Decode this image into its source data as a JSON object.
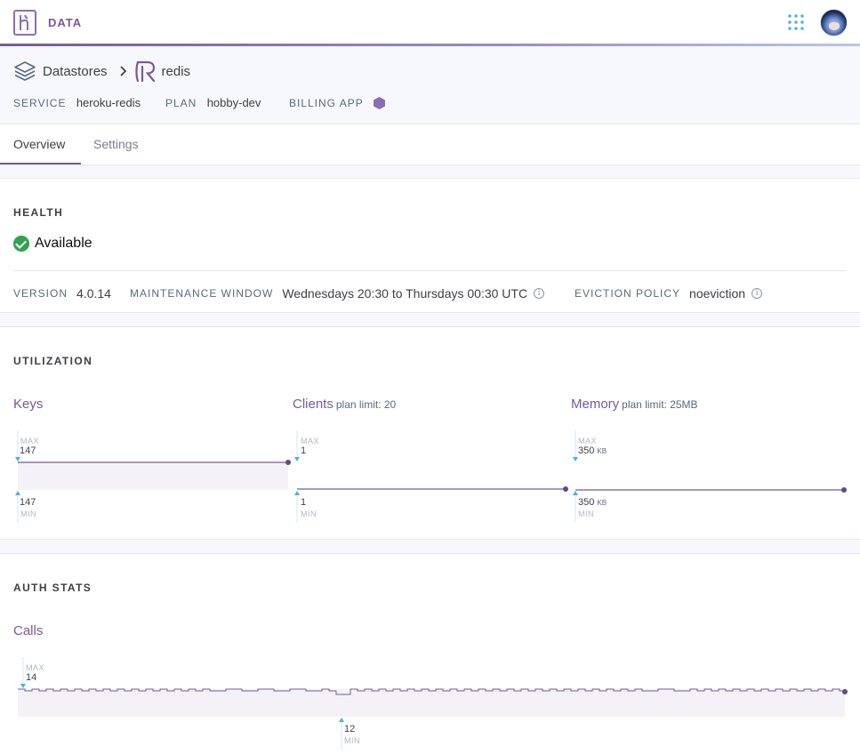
{
  "topbar": {
    "app_name": "DATA"
  },
  "breadcrumb": {
    "parent": "Datastores",
    "current": "redis"
  },
  "service": {
    "service_label": "SERVICE",
    "service_value": "heroku-redis",
    "plan_label": "PLAN",
    "plan_value": "hobby-dev",
    "billing_label": "BILLING APP"
  },
  "tabs": [
    {
      "label": "Overview"
    },
    {
      "label": "Settings"
    }
  ],
  "health": {
    "title": "HEALTH",
    "status": "Available",
    "version_label": "VERSION",
    "version_value": "4.0.14",
    "maintenance_label": "MAINTENANCE WINDOW",
    "maintenance_value": "Wednesdays 20:30 to Thursdays 00:30 UTC",
    "eviction_label": "EVICTION POLICY",
    "eviction_value": "noeviction"
  },
  "utilization": {
    "title": "UTILIZATION",
    "keys": {
      "title": "Keys",
      "max_label": "MAX",
      "max": "147",
      "min": "147",
      "min_label": "MIN"
    },
    "clients": {
      "title": "Clients",
      "limit": "plan limit: 20",
      "max_label": "MAX",
      "max": "1",
      "min": "1",
      "min_label": "MIN"
    },
    "memory": {
      "title": "Memory",
      "limit": "plan limit: 25MB",
      "max_label": "MAX",
      "max": "350",
      "max_unit": "KB",
      "min": "350",
      "min_unit": "KB",
      "min_label": "MIN"
    }
  },
  "auth": {
    "title": "AUTH STATS",
    "calls": {
      "title": "Calls",
      "max_label": "MAX",
      "max": "14",
      "min": "12",
      "min_label": "MIN"
    }
  },
  "colors": {
    "accent": "#79589f",
    "success": "#30a34d",
    "marker": "#3fb6e3"
  }
}
